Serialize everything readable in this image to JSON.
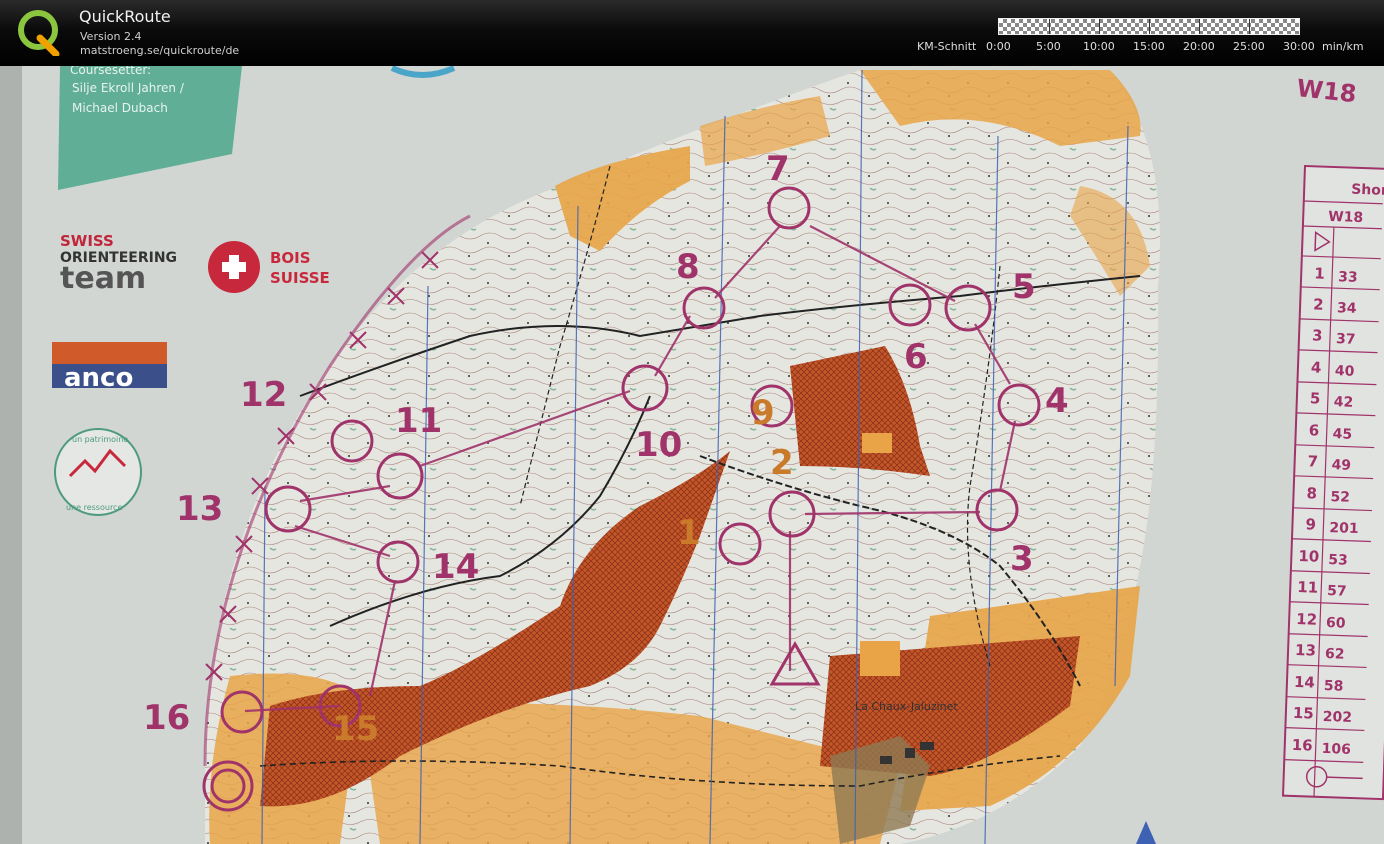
{
  "header": {
    "app_title": "QuickRoute",
    "version": "Version 2.4",
    "url": "matstroeng.se/quickroute/de",
    "scale_label": "KM-Schnitt",
    "scale_ticks": [
      "0:00",
      "5:00",
      "10:00",
      "15:00",
      "20:00",
      "25:00",
      "30:00"
    ],
    "scale_unit": "min/km"
  },
  "map": {
    "course_name": "W18",
    "course_setter_label": "Coursesetter:",
    "course_setter_names": "Silje Ekroll Jahren /",
    "course_setter_names_2": "Michael Dubach",
    "sponsors": {
      "swiss_orienteering_line1": "SWISS",
      "swiss_orienteering_line2": "ORIENTEERING",
      "swiss_orienteering_line3": "team",
      "bois_suisse_line1": "BOIS",
      "bois_suisse_line2": "SUISSE",
      "anco": "anco",
      "patrimoine_top": "un patrimoine",
      "patrimoine_bottom": "une ressource"
    },
    "place_label": "La Chaux-Jaluzinet",
    "control_numbers": [
      "1",
      "2",
      "3",
      "4",
      "5",
      "6",
      "7",
      "8",
      "9",
      "10",
      "11",
      "12",
      "13",
      "14",
      "15",
      "16"
    ],
    "control_table": {
      "header": "Short",
      "course": "W18",
      "rows": [
        {
          "n": "1",
          "code": "33"
        },
        {
          "n": "2",
          "code": "34"
        },
        {
          "n": "3",
          "code": "37"
        },
        {
          "n": "4",
          "code": "40"
        },
        {
          "n": "5",
          "code": "42"
        },
        {
          "n": "6",
          "code": "45"
        },
        {
          "n": "7",
          "code": "49"
        },
        {
          "n": "8",
          "code": "52"
        },
        {
          "n": "9",
          "code": "201"
        },
        {
          "n": "10",
          "code": "53"
        },
        {
          "n": "11",
          "code": "57"
        },
        {
          "n": "12",
          "code": "60"
        },
        {
          "n": "13",
          "code": "62"
        },
        {
          "n": "14",
          "code": "58"
        },
        {
          "n": "15",
          "code": "202"
        },
        {
          "n": "16",
          "code": "106"
        }
      ]
    },
    "colors": {
      "course_magenta": "#a0336a",
      "orange_field": "#e8a446",
      "out_of_bounds": "#c0501f",
      "paper": "#d6dad7",
      "forest_white": "#e7e7e3"
    }
  }
}
